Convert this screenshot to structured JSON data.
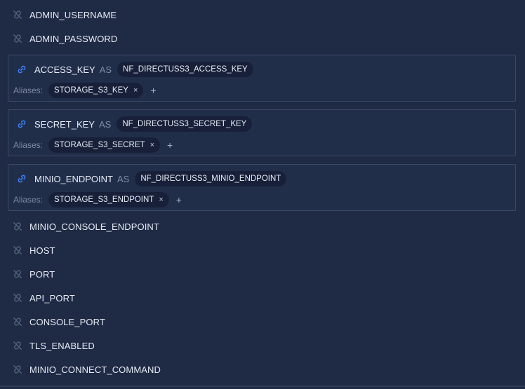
{
  "plain_top": [
    {
      "name": "ADMIN_USERNAME"
    },
    {
      "name": "ADMIN_PASSWORD"
    }
  ],
  "cards": [
    {
      "name": "ACCESS_KEY",
      "as": "AS",
      "target": "NF_DIRECTUSS3_ACCESS_KEY",
      "aliases_label": "Aliases:",
      "alias": "STORAGE_S3_KEY",
      "remove": "×",
      "add": "+"
    },
    {
      "name": "SECRET_KEY",
      "as": "AS",
      "target": "NF_DIRECTUSS3_SECRET_KEY",
      "aliases_label": "Aliases:",
      "alias": "STORAGE_S3_SECRET",
      "remove": "×",
      "add": "+"
    },
    {
      "name": "MINIO_ENDPOINT",
      "as": "AS",
      "target": "NF_DIRECTUSS3_MINIO_ENDPOINT",
      "aliases_label": "Aliases:",
      "alias": "STORAGE_S3_ENDPOINT",
      "remove": "×",
      "add": "+"
    }
  ],
  "plain_bottom": [
    {
      "name": "MINIO_CONSOLE_ENDPOINT"
    },
    {
      "name": "HOST"
    },
    {
      "name": "PORT"
    },
    {
      "name": "API_PORT"
    },
    {
      "name": "CONSOLE_PORT"
    },
    {
      "name": "TLS_ENABLED"
    },
    {
      "name": "MINIO_CONNECT_COMMAND"
    }
  ],
  "icons": {
    "linked": "link-icon",
    "unlinked": "unlink-icon"
  },
  "colors": {
    "background": "#1f2a44",
    "link_accent": "#3b82f6",
    "muted": "#7f8aa3",
    "pill": "#172038"
  }
}
